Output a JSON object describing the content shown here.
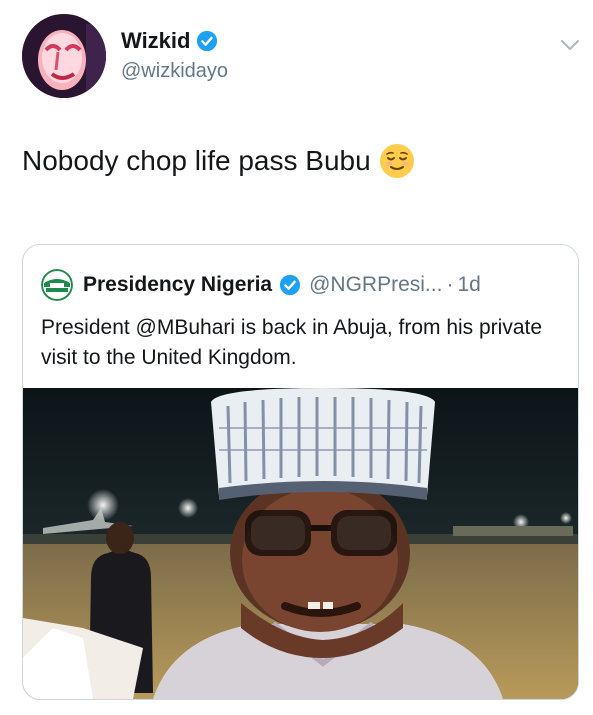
{
  "tweet": {
    "author_name": "Wizkid",
    "author_handle": "@wizkidayo",
    "text": "Nobody chop life pass Bubu",
    "emoji": "relieved-face"
  },
  "quoted_tweet": {
    "author_name": "Presidency Nigeria",
    "author_handle": "@NGRPresi...",
    "separator": "·",
    "time": "1d",
    "text": "President @MBuhari is back in Abuja, from his private visit to the United Kingdom."
  },
  "colors": {
    "verified_blue": "#1da1f2",
    "muted_text": "#657786",
    "border": "#ccd6dd"
  },
  "icons": [
    "verified-badge-icon",
    "chevron-down-icon",
    "relieved-face-emoji"
  ]
}
